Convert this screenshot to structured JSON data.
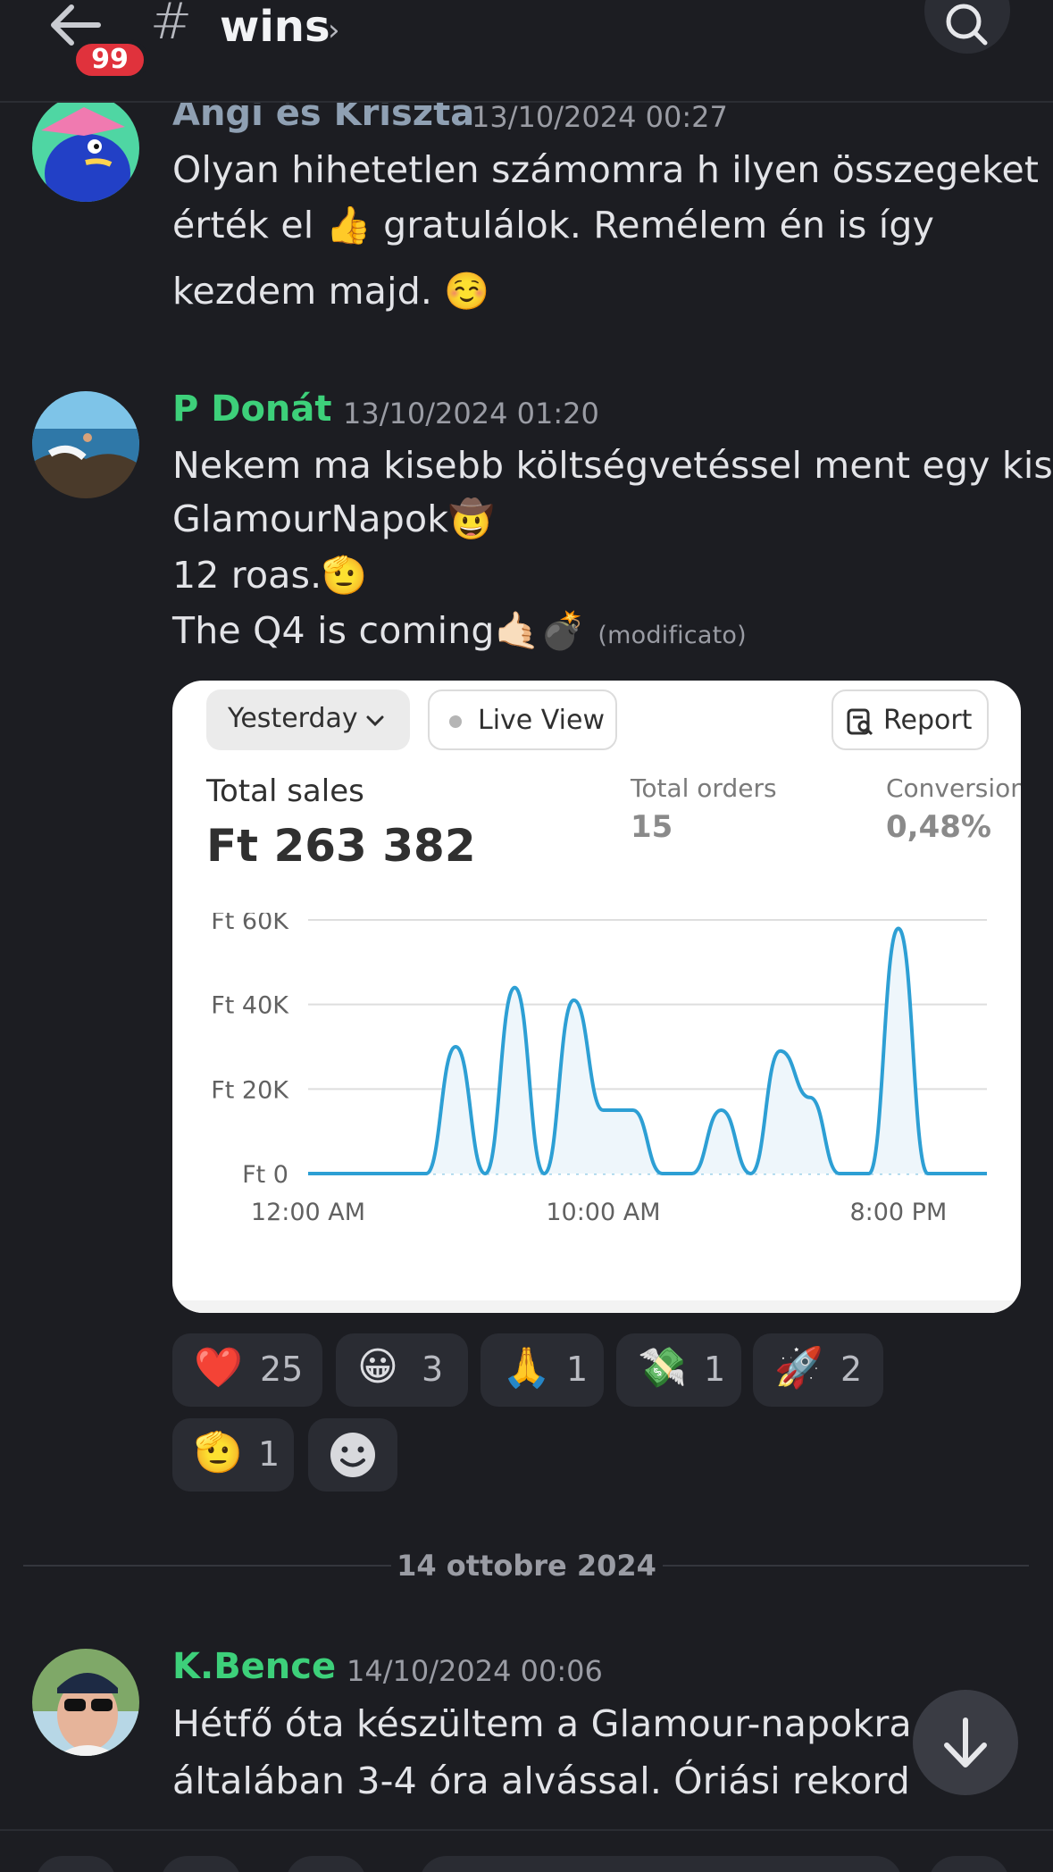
{
  "header": {
    "unread_badge": "99",
    "hash": "#",
    "channel_name": "wins",
    "chevron": "›"
  },
  "messages": [
    {
      "author": "Angi és Kriszta",
      "author_color": "#8fa0b3",
      "timestamp": "13/10/2024 00:27",
      "lines": [
        "Olyan hihetetlen számomra h ilyen összegeket",
        "érték el 👍 gratulálok. Remélem én is így",
        "kezdem majd. ☺️"
      ]
    },
    {
      "author": "P Donát",
      "author_color": "#3dd07a",
      "timestamp": "13/10/2024 01:20",
      "lines": [
        "Nekem ma kisebb költségvetéssel ment egy kis",
        "GlamourNapok🤠",
        "12 roas.🫡",
        "The Q4 is coming🤙🏻💣"
      ],
      "edited": "(modificato)"
    },
    {
      "author": "K.Bence",
      "author_color": "#3dd07a",
      "timestamp": "14/10/2024 00:06",
      "lines": [
        "Hétfő óta készültem a Glamour-napokra,",
        "általában 3-4 óra alvással.  Óriási rekord"
      ]
    }
  ],
  "card": {
    "period": "Yesterday",
    "live_view": "Live View",
    "report": "Report",
    "total_sales_label": "Total sales",
    "total_sales_value": "Ft 263 382",
    "total_orders_label": "Total orders",
    "total_orders_value": "15",
    "conversion_label": "Conversion",
    "conversion_value": "0,48%"
  },
  "chart_data": {
    "type": "line",
    "title": "",
    "xlabel": "",
    "ylabel": "",
    "ylim": [
      0,
      60000
    ],
    "y_ticks": [
      "Ft 0",
      "Ft 20K",
      "Ft 40K",
      "Ft 60K"
    ],
    "x_ticks": [
      "12:00 AM",
      "10:00 AM",
      "8:00 PM"
    ],
    "grid": true,
    "series": [
      {
        "color": "#2d9fd4",
        "x": [
          "12:00 AM",
          "1:00 AM",
          "2:00 AM",
          "3:00 AM",
          "4:00 AM",
          "5:00 AM",
          "6:00 AM",
          "7:00 AM",
          "8:00 AM",
          "9:00 AM",
          "10:00 AM",
          "11:00 AM",
          "12:00 PM",
          "1:00 PM",
          "2:00 PM",
          "3:00 PM",
          "4:00 PM",
          "5:00 PM",
          "6:00 PM",
          "7:00 PM",
          "8:00 PM",
          "9:00 PM",
          "10:00 PM",
          "11:00 PM"
        ],
        "values": [
          0,
          0,
          0,
          0,
          0,
          30000,
          0,
          44000,
          0,
          41000,
          15000,
          15000,
          0,
          0,
          15000,
          0,
          29000,
          18000,
          0,
          0,
          58000,
          0,
          0,
          0
        ]
      }
    ]
  },
  "reactions": [
    {
      "emoji": "❤️",
      "count": "25"
    },
    {
      "emoji": "😀",
      "count": "3"
    },
    {
      "emoji": "🙏",
      "count": "1"
    },
    {
      "emoji": "💸",
      "count": "1"
    },
    {
      "emoji": "🚀",
      "count": "2"
    },
    {
      "emoji": "🫡",
      "count": "1"
    }
  ],
  "date_divider": "14 ottobre 2024",
  "icons": {
    "back": "back-arrow-icon",
    "search": "search-icon",
    "add_reaction": "add-reaction-icon",
    "jump_down": "arrow-down-icon"
  }
}
